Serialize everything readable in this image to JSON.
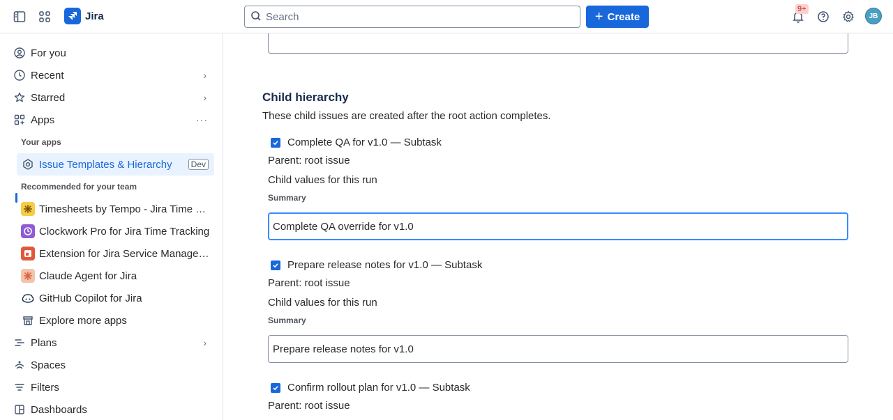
{
  "topbar": {
    "brand": "Jira",
    "search_placeholder": "Search",
    "create_label": "Create",
    "notif_badge": "9+",
    "avatar_initials": "JB"
  },
  "sidebar": {
    "nav": [
      {
        "label": "For you",
        "icon": "user-circle-icon"
      },
      {
        "label": "Recent",
        "icon": "clock-icon"
      },
      {
        "label": "Starred",
        "icon": "star-icon"
      },
      {
        "label": "Apps",
        "icon": "apps-grid-icon"
      }
    ],
    "your_apps_label": "Your apps",
    "active_app": {
      "label": "Issue Templates & Hierarchy",
      "tag": "Dev"
    },
    "recommended_label": "Recommended for your team",
    "recommended": [
      {
        "label": "Timesheets by Tempo - Jira Time Tracking"
      },
      {
        "label": "Clockwork Pro for Jira Time Tracking"
      },
      {
        "label": "Extension for Jira Service Management"
      },
      {
        "label": "Claude Agent for Jira"
      },
      {
        "label": "GitHub Copilot for Jira"
      },
      {
        "label": "Explore more apps"
      }
    ],
    "bottom_nav": [
      {
        "label": "Plans",
        "icon": "plans-icon"
      },
      {
        "label": "Spaces",
        "icon": "spaces-icon"
      },
      {
        "label": "Filters",
        "icon": "filter-icon"
      },
      {
        "label": "Dashboards",
        "icon": "dashboard-icon"
      }
    ]
  },
  "main": {
    "heading": "Child hierarchy",
    "description": "These child issues are created after the root action completes.",
    "children": [
      {
        "title": "Complete QA for v1.0 — Subtask",
        "parent": "Parent: root issue",
        "values_label": "Child values for this run",
        "summary_label": "Summary",
        "summary_value": "Complete QA override for v1.0"
      },
      {
        "title": "Prepare release notes for v1.0 — Subtask",
        "parent": "Parent: root issue",
        "values_label": "Child values for this run",
        "summary_label": "Summary",
        "summary_value": "Prepare release notes for v1.0"
      },
      {
        "title": "Confirm rollout plan for v1.0 — Subtask",
        "parent": "Parent: root issue"
      }
    ]
  }
}
